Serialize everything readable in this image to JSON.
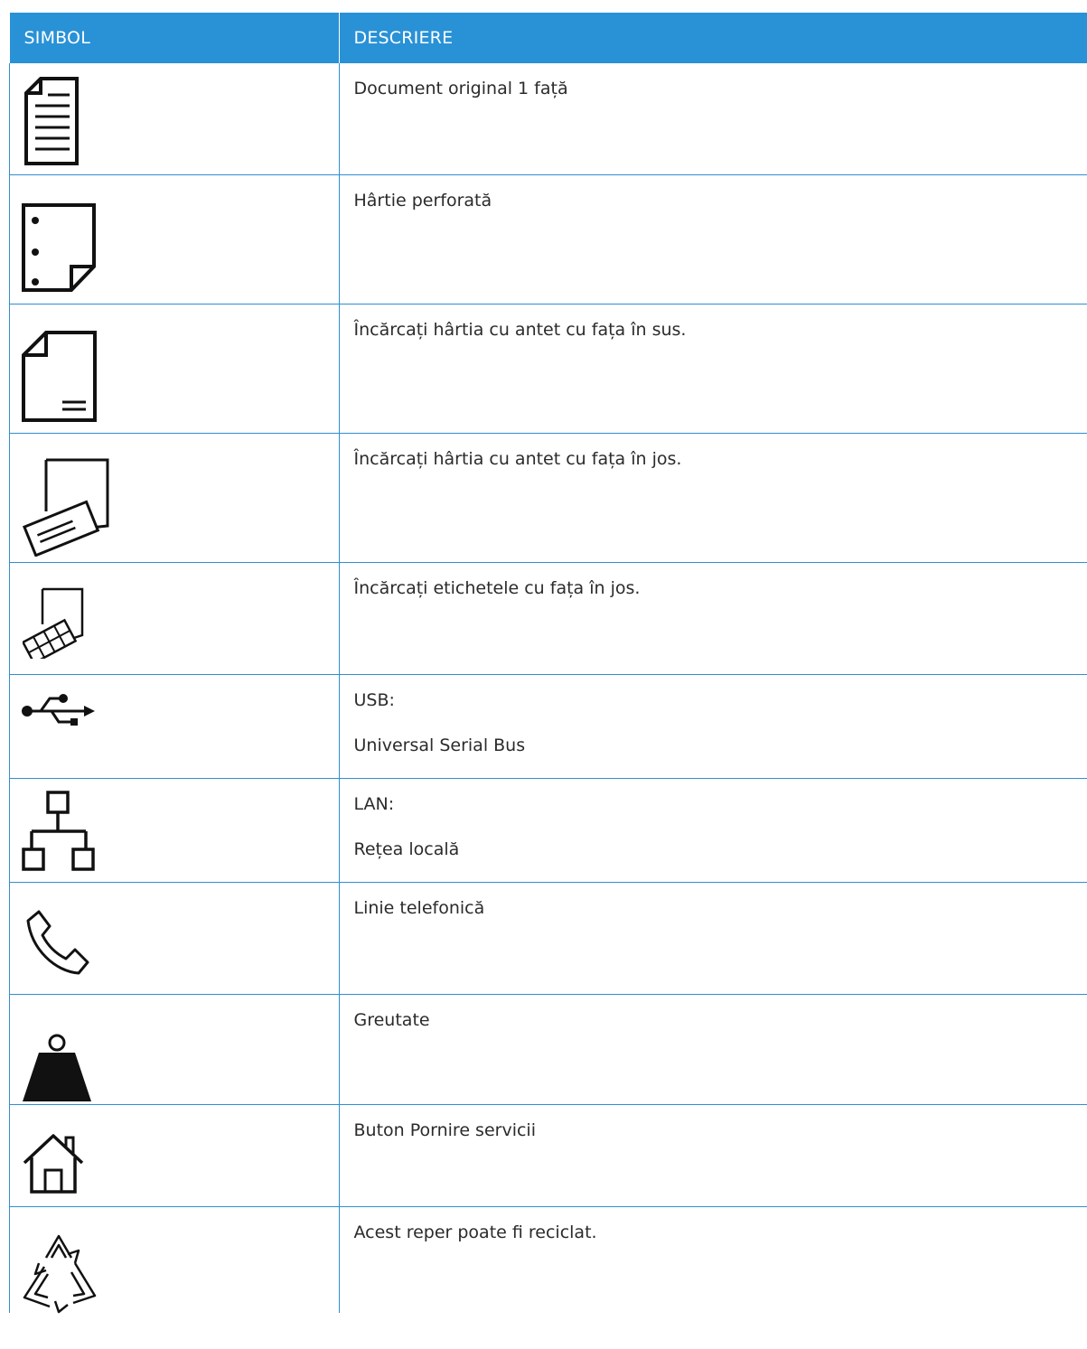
{
  "header": {
    "symbol": "SIMBOL",
    "description": "DESCRIERE"
  },
  "rows": [
    {
      "icon": "one-sided-original-icon",
      "lines": [
        "Document original 1 față"
      ]
    },
    {
      "icon": "punched-paper-icon",
      "lines": [
        "Hârtie perforată"
      ]
    },
    {
      "icon": "letterhead-face-up-icon",
      "lines": [
        "Încărcați hârtia cu antet cu fața în sus."
      ]
    },
    {
      "icon": "letterhead-face-down-icon",
      "lines": [
        "Încărcați hârtia cu antet cu fața în jos."
      ]
    },
    {
      "icon": "labels-face-down-icon",
      "lines": [
        "Încărcați etichetele cu fața în jos."
      ]
    },
    {
      "icon": "usb-icon",
      "lines": [
        "USB:",
        "Universal Serial Bus"
      ]
    },
    {
      "icon": "lan-icon",
      "lines": [
        "LAN:",
        "Rețea locală"
      ]
    },
    {
      "icon": "telephone-line-icon",
      "lines": [
        "Linie telefonică"
      ]
    },
    {
      "icon": "weight-icon",
      "lines": [
        "Greutate"
      ]
    },
    {
      "icon": "services-home-icon",
      "lines": [
        "Buton Pornire servicii"
      ]
    },
    {
      "icon": "recycle-icon",
      "lines": [
        "Acest reper poate fi reciclat."
      ]
    }
  ],
  "colors": {
    "header_bg": "#2991d6",
    "border": "#2f8fd1",
    "text": "#2b2b2b"
  }
}
